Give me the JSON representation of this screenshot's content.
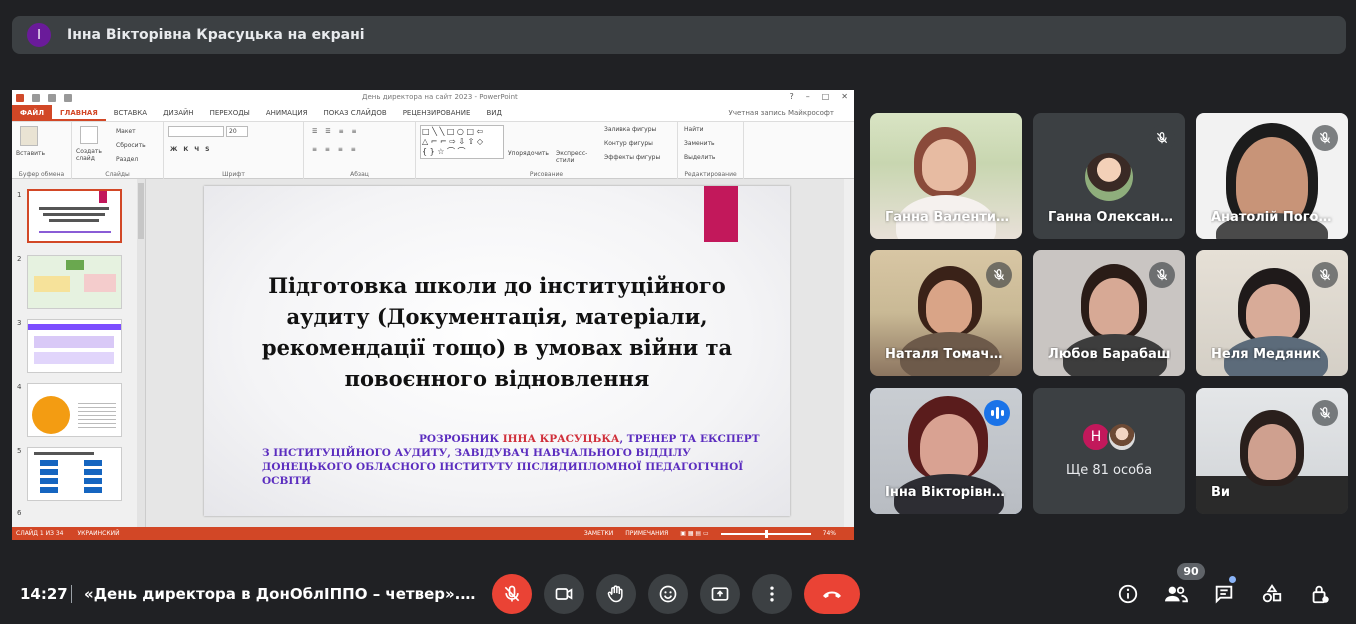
{
  "presenter_bar": {
    "avatar_letter": "I",
    "text": "Інна Вікторівна Красуцька на екрані"
  },
  "ppt": {
    "window_title": "День директора на сайт 2023 - PowerPoint",
    "tabs": [
      "ФАЙЛ",
      "ГЛАВНАЯ",
      "ВСТАВКА",
      "ДИЗАЙН",
      "ПЕРЕХОДЫ",
      "АНИМАЦИЯ",
      "ПОКАЗ СЛАЙДОВ",
      "РЕЦЕНЗИРОВАНИЕ",
      "ВИД"
    ],
    "account": "Учетная запись Майкрософт",
    "ribbon": {
      "paste": "Вставить",
      "clipboard": "Буфер обмена",
      "create_slide": "Создать слайд",
      "layout": "Макет",
      "reset": "Сбросить",
      "section": "Раздел",
      "slides": "Слайды",
      "font": "Шрифт",
      "font_size": "20",
      "paragraph": "Абзац",
      "arrange": "Упорядочить",
      "quick_styles": "Экспресс-стили",
      "fill": "Заливка фигуры",
      "outline": "Контур фигуры",
      "effects": "Эффекты фигуры",
      "drawing": "Рисование",
      "find": "Найти",
      "replace": "Заменить",
      "select": "Выделить",
      "editing": "Редактирование"
    },
    "thumb_numbers": [
      "1",
      "2",
      "3",
      "4",
      "5",
      "6"
    ],
    "slide": {
      "heading": "Підготовка школи до інституційного аудиту (Документація, матеріали, рекомендації тощо) в умовах війни та повоєнного відновлення",
      "author_prefix": "РОЗРОБНИК ",
      "author_name": "ІННА КРАСУЦЬКА",
      "author_rest": ", ТРЕНЕР ТА ЕКСПЕРТ З ІНСТИТУЦІЙНОГО АУДИТУ, ЗАВІДУВАЧ НАВЧАЛЬНОГО ВІДДІЛУ ДОНЕЦЬКОГО ОБЛАСНОГО ІНСТИТУТУ ПІСЛЯДИПЛОМНОЇ ПЕДАГОГІЧНОЇ ОСВІТИ"
    },
    "status": {
      "slide_info": "СЛАЙД 1 ИЗ 34",
      "language": "УКРАИНСКИЙ",
      "notes": "ЗАМЕТКИ",
      "comments": "ПРИМЕЧАНИЯ",
      "zoom": "74%"
    }
  },
  "participants": [
    {
      "name": "Ганна Валентинівна",
      "muted": false
    },
    {
      "name": "Ганна Олександрівна",
      "muted": true
    },
    {
      "name": "Анатолій Погорілий",
      "muted": true
    },
    {
      "name": "Наталя Томачинська",
      "muted": true
    },
    {
      "name": "Любов Барабаш",
      "muted": true
    },
    {
      "name": "Неля Медяник",
      "muted": true
    },
    {
      "name": "Інна Вікторівна Красуцька",
      "speaking": true
    },
    {
      "more_letter": "Н",
      "more_label": "Ще 81 особа"
    },
    {
      "name": "Ви",
      "muted": true
    }
  ],
  "bottom": {
    "time": "14:27",
    "meeting_title": "«День директора в ДонОблІППО – четвер».…",
    "participants_count": "90"
  },
  "colors": {
    "end_call": "#ea4335",
    "accent": "#8ab4f8",
    "ppt_orange": "#d24726"
  }
}
